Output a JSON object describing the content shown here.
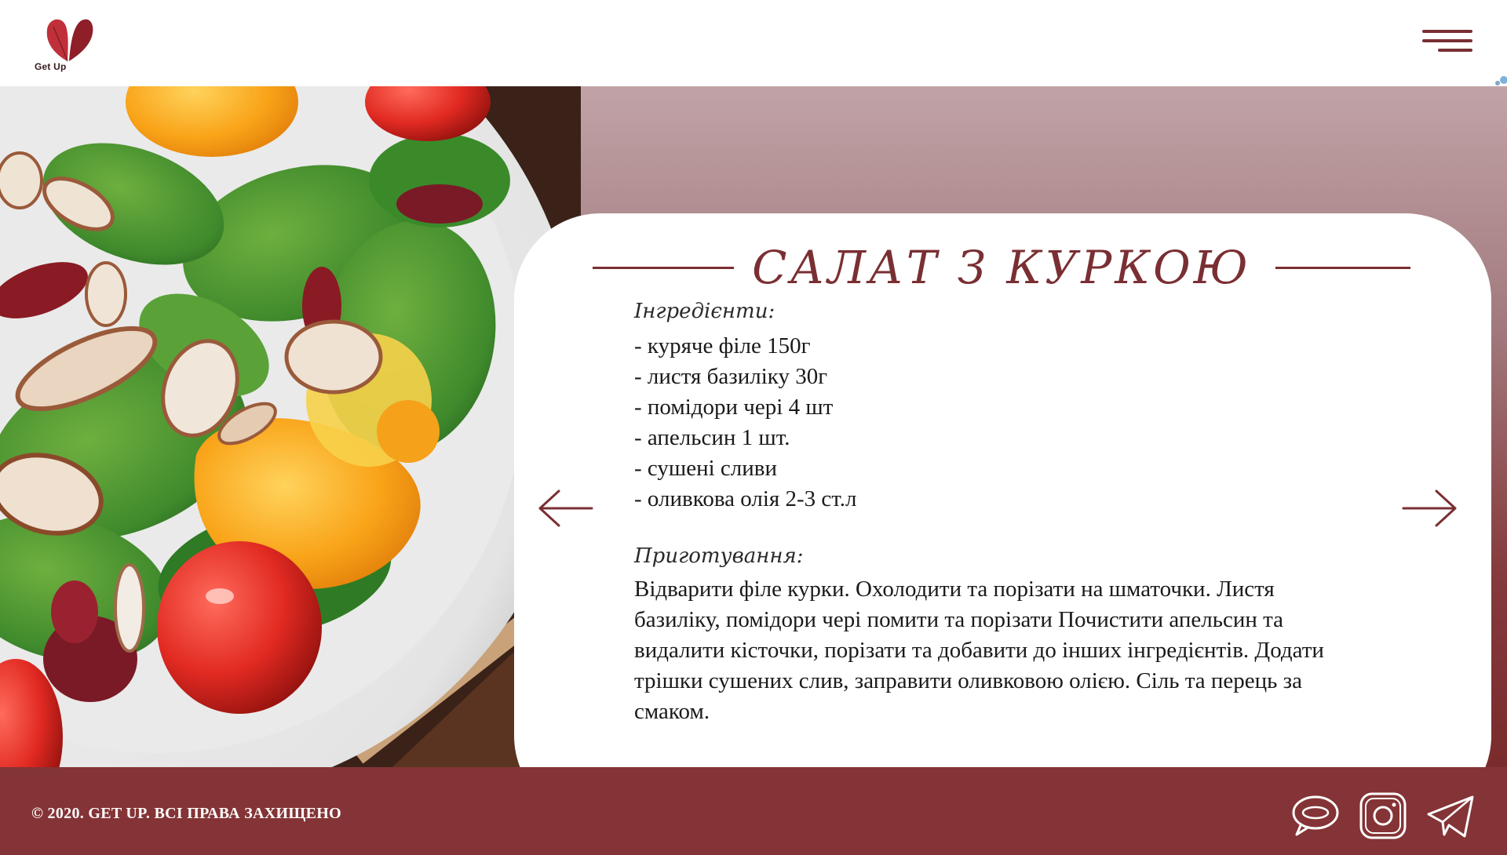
{
  "brand": {
    "logo_text": "Get Up",
    "logo_icon": "heart-leaves-icon"
  },
  "header": {
    "menu_icon": "hamburger-menu-icon"
  },
  "recipe": {
    "title": "САЛАТ З КУРКОЮ",
    "ingredients_label": "Інгредієнти:",
    "ingredients": [
      "- куряче філе 150г",
      "- листя базиліку 30г",
      "- помідори чері 4 шт",
      "- апельсин 1 шт.",
      "- сушені сливи",
      "- оливкова олія 2-3 ст.л"
    ],
    "preparation_label": "Приготування:",
    "preparation": "Відварити філе курки. Охолодити та порізати на шматочки. Листя базиліку, помідори чері помити та порізати  Почистити апельсин та видалити кісточки, порізати та добавити до інших інгредієнтів. Додати трішки сушених слив, заправити оливковою олією. Сіль та перець за смаком."
  },
  "nav": {
    "prev_icon": "arrow-left-icon",
    "next_icon": "arrow-right-icon"
  },
  "footer": {
    "copyright": "© 2020. GET UP. ВСІ ПРАВА ЗАХИЩЕНО",
    "social": [
      "chat-bubble-icon",
      "instagram-icon",
      "telegram-icon"
    ]
  },
  "colors": {
    "accent": "#7a2f33",
    "footer_bg": "#843436",
    "card_bg": "#ffffff"
  }
}
